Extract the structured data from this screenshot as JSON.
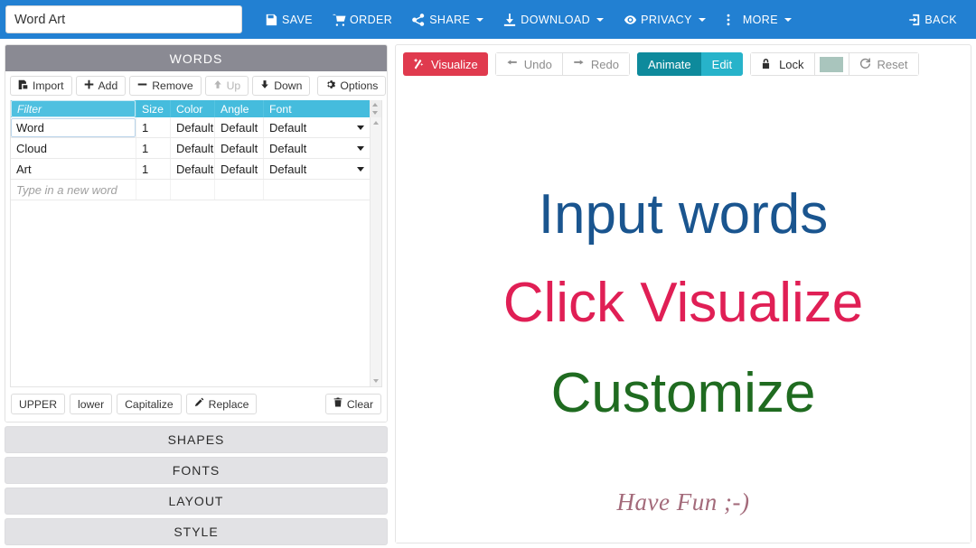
{
  "topbar": {
    "doc_title_value": "Word Art",
    "doc_title_placeholder": "Title",
    "buttons": [
      {
        "label": "SAVE",
        "icon": "save-icon",
        "caret": false
      },
      {
        "label": "ORDER",
        "icon": "cart-icon",
        "caret": false
      },
      {
        "label": "SHARE",
        "icon": "share-icon",
        "caret": true
      },
      {
        "label": "DOWNLOAD",
        "icon": "download-icon",
        "caret": true
      },
      {
        "label": "PRIVACY",
        "icon": "eye-icon",
        "caret": true
      },
      {
        "label": "MORE",
        "icon": "ellipsis-vertical-icon",
        "caret": true
      }
    ],
    "back_label": "BACK",
    "back_icon": "sign-out-icon",
    "bg_color": "#2280d2"
  },
  "words_panel": {
    "header": "WORDS",
    "header_bg": "#8a8a93",
    "toolbar": [
      {
        "label": "Import",
        "icon": "import-icon",
        "disabled": false
      },
      {
        "label": "Add",
        "icon": "plus-icon",
        "disabled": false
      },
      {
        "label": "Remove",
        "icon": "minus-icon",
        "disabled": false
      },
      {
        "label": "Up",
        "icon": "arrow-up-icon",
        "disabled": true
      },
      {
        "label": "Down",
        "icon": "arrow-down-icon",
        "disabled": false
      }
    ],
    "options_label": "Options",
    "options_icon": "gear-icon",
    "table": {
      "header_bg": "#45bcdd",
      "filter_placeholder": "Filter",
      "filter_value": "",
      "columns": [
        "Size",
        "Color",
        "Angle",
        "Font"
      ],
      "rows": [
        {
          "word": "Word",
          "size": "1",
          "color": "Default",
          "angle": "Default",
          "font": "Default",
          "editing": true
        },
        {
          "word": "Cloud",
          "size": "1",
          "color": "Default",
          "angle": "Default",
          "font": "Default",
          "editing": false
        },
        {
          "word": "Art",
          "size": "1",
          "color": "Default",
          "angle": "Default",
          "font": "Default",
          "editing": false
        }
      ],
      "new_row_placeholder": "Type in a new word"
    },
    "case_buttons": [
      {
        "label": "UPPER",
        "icon": ""
      },
      {
        "label": "lower",
        "icon": ""
      },
      {
        "label": "Capitalize",
        "icon": ""
      },
      {
        "label": "Replace",
        "icon": "edit-icon"
      }
    ],
    "clear_label": "Clear",
    "clear_icon": "trash-icon"
  },
  "accordion": [
    {
      "label": "SHAPES"
    },
    {
      "label": "FONTS"
    },
    {
      "label": "LAYOUT"
    },
    {
      "label": "STYLE"
    }
  ],
  "canvas_toolbar": {
    "visualize": {
      "label": "Visualize",
      "icon": "magic-wand-icon",
      "color": "#e03a4e"
    },
    "undo": {
      "label": "Undo",
      "icon": "arrow-left-icon"
    },
    "redo": {
      "label": "Redo",
      "icon": "arrow-right-icon"
    },
    "animate": {
      "label": "Animate",
      "color": "#0e8a9c"
    },
    "edit": {
      "label": "Edit",
      "color": "#27b3ca"
    },
    "lock": {
      "label": "Lock",
      "icon": "lock-icon"
    },
    "swatch_color": "#a9c5bd",
    "reset": {
      "label": "Reset",
      "icon": "refresh-icon"
    }
  },
  "canvas": {
    "lines": [
      {
        "text": "Input words",
        "color": "#1a558f"
      },
      {
        "text": "Click Visualize",
        "color": "#e01f55"
      },
      {
        "text": "Customize",
        "color": "#1f6b20"
      },
      {
        "text": "Have Fun ;-)",
        "color": "#a36a7a"
      }
    ]
  }
}
